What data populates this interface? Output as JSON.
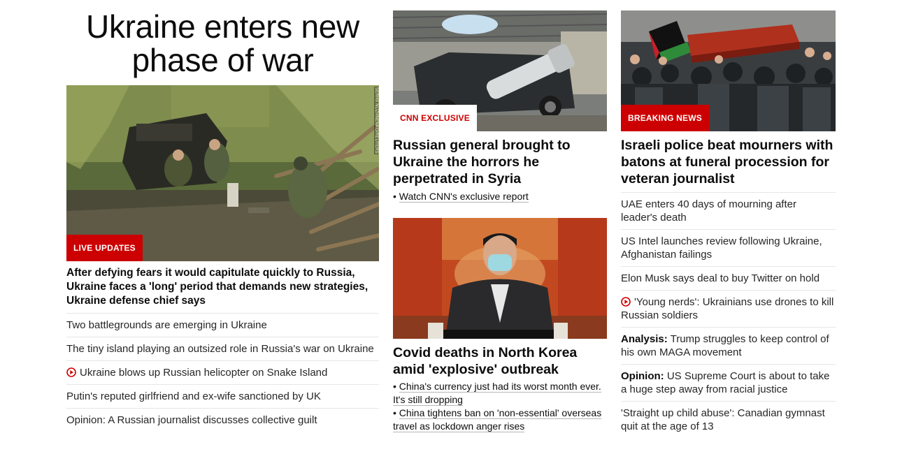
{
  "column1": {
    "headline_line1": "Ukraine enters new",
    "headline_line2": "phase of war",
    "badge": "LIVE UPDATES",
    "photo_credit": "SERHII NUZHNENKO/REUTERS",
    "lead_title": "After defying fears it would capitulate quickly to Russia, Ukraine faces a 'long' period that demands new strategies, Ukraine defense chief says",
    "links": [
      {
        "text": "Two battlegrounds are emerging in Ukraine",
        "video": false
      },
      {
        "text": "The tiny island playing an outsized role in Russia's war on Ukraine",
        "video": false
      },
      {
        "text": "Ukraine blows up Russian helicopter on Snake Island",
        "video": true
      },
      {
        "text": "Putin's reputed girlfriend and ex-wife sanctioned by UK",
        "video": false
      },
      {
        "text": "Opinion: A Russian journalist discusses collective guilt",
        "video": false
      }
    ]
  },
  "column2": {
    "story1": {
      "badge": "CNN EXCLUSIVE",
      "title": "Russian general brought to Ukraine the horrors he perpetrated in Syria",
      "bullet": "Watch CNN's exclusive report"
    },
    "story2": {
      "title": "Covid deaths in North Korea amid 'explosive' outbreak",
      "bullets": [
        "China's currency just had its worst month ever. It's still dropping",
        "China tightens ban on 'non-essential' overseas travel as lockdown anger rises"
      ]
    }
  },
  "column3": {
    "badge": "BREAKING NEWS",
    "title": "Israeli police beat mourners with batons at funeral procession for veteran journalist",
    "links": [
      {
        "prefix": "",
        "text": "UAE enters 40 days of mourning after leader's death",
        "video": false
      },
      {
        "prefix": "",
        "text": "US Intel launches review following Ukraine, Afghanistan failings",
        "video": false
      },
      {
        "prefix": "",
        "text": "Elon Musk says deal to buy Twitter on hold",
        "video": false
      },
      {
        "prefix": "",
        "text": "'Young nerds': Ukrainians use drones to kill Russian soldiers",
        "video": true
      },
      {
        "prefix": "Analysis:",
        "text": "Trump struggles to keep control of his own MAGA movement",
        "video": false
      },
      {
        "prefix": "Opinion:",
        "text": "US Supreme Court is about to take a huge step away from racial justice",
        "video": false
      },
      {
        "prefix": "",
        "text": "'Straight up child abuse': Canadian gymnast quit at the age of 13",
        "video": false
      }
    ]
  },
  "colors": {
    "badge_red": "#cc0000",
    "text": "#0c0c0c",
    "divider": "#e6e6e6"
  },
  "icons": {
    "video": "play-circle-icon"
  }
}
